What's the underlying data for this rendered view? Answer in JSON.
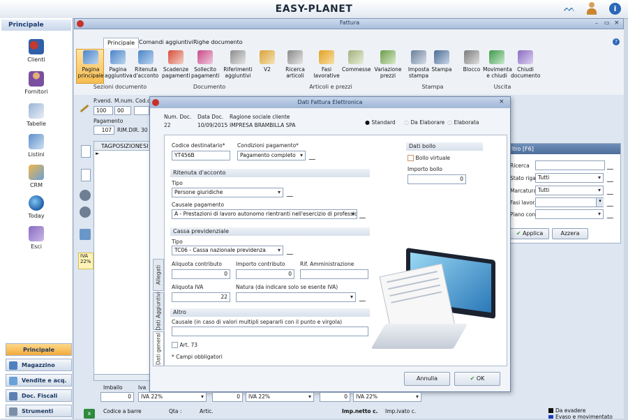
{
  "app": {
    "title": "EASY-PLANET"
  },
  "left_nav": {
    "header": "Principale",
    "items": [
      {
        "label": "Clienti",
        "icon": "users-icon"
      },
      {
        "label": "Fornitori",
        "icon": "person-icon"
      },
      {
        "label": "Tabelle",
        "icon": "tables-icon"
      },
      {
        "label": "Listini",
        "icon": "book-icon"
      },
      {
        "label": "CRM",
        "icon": "crm-icon"
      },
      {
        "label": "Today",
        "icon": "globe-icon"
      },
      {
        "label": "Esci",
        "icon": "exit-icon"
      }
    ],
    "bottom": [
      {
        "label": "Principale"
      },
      {
        "label": "Magazzino"
      },
      {
        "label": "Vendite e acq."
      },
      {
        "label": "Doc. Fiscali"
      },
      {
        "label": "Strumenti"
      }
    ]
  },
  "window": {
    "title": "Fattura"
  },
  "ribbon": {
    "tabs": [
      "Principale",
      "Comandi aggiuntivi",
      "Righe documento"
    ],
    "buttons": [
      {
        "label": "Pagina principale"
      },
      {
        "label": "Pagina aggiuntiva"
      },
      {
        "label": "Ritenuta d'acconto"
      },
      {
        "label": "Scadenze pagamenti"
      },
      {
        "label": "Sollecito pagamenti"
      },
      {
        "label": "Riferimenti aggiuntivi"
      },
      {
        "label": "V2"
      },
      {
        "label": "Ricerca articoli"
      },
      {
        "label": "Fasi lavorative"
      },
      {
        "label": "Commesse"
      },
      {
        "label": "Variazione prezzi"
      },
      {
        "label": "Imposta stampa"
      },
      {
        "label": "Stampa"
      },
      {
        "label": "Blocco"
      },
      {
        "label": "Movimenta e chiudi"
      },
      {
        "label": "Chiudi documento"
      }
    ],
    "groups": [
      "Sezioni documento",
      "Documento",
      "Articoli e prezzi",
      "Stampa",
      "Uscita"
    ]
  },
  "doc": {
    "pvend_label": "P.vend.",
    "pvend_value": "100",
    "mnum_label": "M.num.",
    "mnum_value": "00",
    "cod_label": "Cod.c",
    "pagamento_label": "Pagamento",
    "pagamento_code": "107",
    "pagamento_text": "RIM.DIR. 30",
    "grid_headers": [
      "TAG",
      "POSIZIONE",
      "SI"
    ],
    "iva_label": "IVA",
    "iva_value": "22%"
  },
  "filter": {
    "title": "ltro [F6]",
    "fields": [
      {
        "label": "Ricerca",
        "value": ""
      },
      {
        "label": "Stato riga",
        "value": "Tutti"
      },
      {
        "label": "Marcatura",
        "value": "Tutti"
      },
      {
        "label": "Fasi lavor.",
        "value": ""
      },
      {
        "label": "Piano conti",
        "value": ""
      }
    ],
    "apply": "Applica",
    "reset": "Azzera"
  },
  "modal": {
    "title": "Dati Fattura Elettronica",
    "num_doc_label": "Num. Doc.",
    "num_doc": "22",
    "data_doc_label": "Data Doc.",
    "data_doc": "10/09/2015",
    "ragione_label": "Ragione sociale cliente",
    "ragione": "IMPRESA BRAMBILLA SPA",
    "radio": [
      "Standard",
      "Da Elaborare",
      "Elaborata"
    ],
    "codice_dest_label": "Codice destinatario*",
    "codice_dest": "YT456B",
    "condizioni_label": "Condizioni pagamento*",
    "condizioni": "Pagamento completo",
    "ritenuta_section": "Ritenuta d'acconto",
    "tipo_label": "Tipo",
    "tipo_ritenuta": "Persone giuridiche",
    "causale_label": "Causale pagamento",
    "causale": "A - Prestazioni di lavoro autonomo rientranti nell'esercizio di professione...",
    "cassa_section": "Cassa previdenziale",
    "tipo_cassa": "TC06 - Cassa nazionale previdenza",
    "aliquota_contr_label": "Aliquota contributo",
    "aliquota_contr": "0",
    "importo_contr_label": "Importo contributo",
    "importo_contr": "0",
    "rif_amm_label": "Rif. Amministrazione",
    "rif_amm": "",
    "aliquota_iva_label": "Aliquota IVA",
    "aliquota_iva": "22",
    "natura_label": "Natura (da indicare solo se esente IVA)",
    "natura": "",
    "altro_section": "Altro",
    "causale_altro_label": "Causale (in caso di valori multipli separarli con il punto e virgola)",
    "art73": "Art. 73",
    "campi_obbl": "* Campi obbligatori",
    "bollo_section": "Dati bollo",
    "bollo_virtuale": "Bollo virtuale",
    "importo_bollo_label": "Importo bollo",
    "importo_bollo": "0",
    "vtabs": [
      "Allegati",
      "Dati Aggiuntivi",
      "Dati general"
    ],
    "annulla": "Annulla",
    "ok": "OK"
  },
  "bottom": {
    "imballo_label": "Imballo",
    "iva_short": "Iva",
    "vals": [
      "0",
      "0",
      "0"
    ],
    "iva_sel": [
      "IVA 22%",
      "IVA 22%",
      "IVA 22%"
    ],
    "codice_barre": "Codice a barre",
    "qta": "Qta :",
    "artic": "Artic.",
    "imp_netto": "Imp.netto c.",
    "imp_ivato": "Imp.ivato c.",
    "legend": [
      "Da evadere",
      "Evaso e movimentato"
    ]
  }
}
